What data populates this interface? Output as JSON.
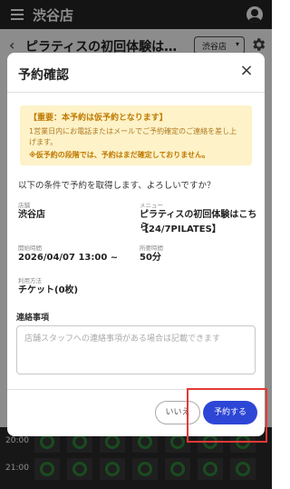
{
  "app": {
    "title": "渋谷店",
    "class_title": "ピラティスの初回体験はこちら",
    "studio_select": "渋谷店",
    "schedule_times": [
      "20:00",
      "21:00"
    ]
  },
  "modal": {
    "title": "予約確認",
    "close_label": "×",
    "notice": {
      "title": "【重要：本予約は仮予約となります】",
      "body": "1営業日内にお電話またはメールでご予約確定のご連絡を差し上げます。",
      "warning": "※仮予約の段階では、予約はまだ確定しておりません。"
    },
    "confirm_question": "以下の条件で予約を取得します、よろしいですか？",
    "fields": {
      "store_label": "店舗",
      "store_value": "渋谷店",
      "menu_label": "メニュー",
      "menu_value_line1": "ピラティスの初回体験はこちら",
      "menu_value_line2": "【24/7PILATES】",
      "start_label": "開始時間",
      "start_value": "2026/04/07 13:00 ~",
      "duration_label": "所要時間",
      "duration_value": "50分",
      "payment_label": "利用方法",
      "payment_value": "チケット(0枚)"
    },
    "memo": {
      "label": "連絡事項",
      "placeholder": "店舗スタッフへの連絡事項がある場合は記載できます"
    },
    "buttons": {
      "no": "いいえ",
      "yes": "予約する"
    }
  },
  "colors": {
    "primary": "#2d46d6",
    "notice_bg": "#fdf2c8",
    "notice_text": "#c07a00",
    "highlight": "#e53935",
    "slot_available": "#2e8b3a"
  }
}
